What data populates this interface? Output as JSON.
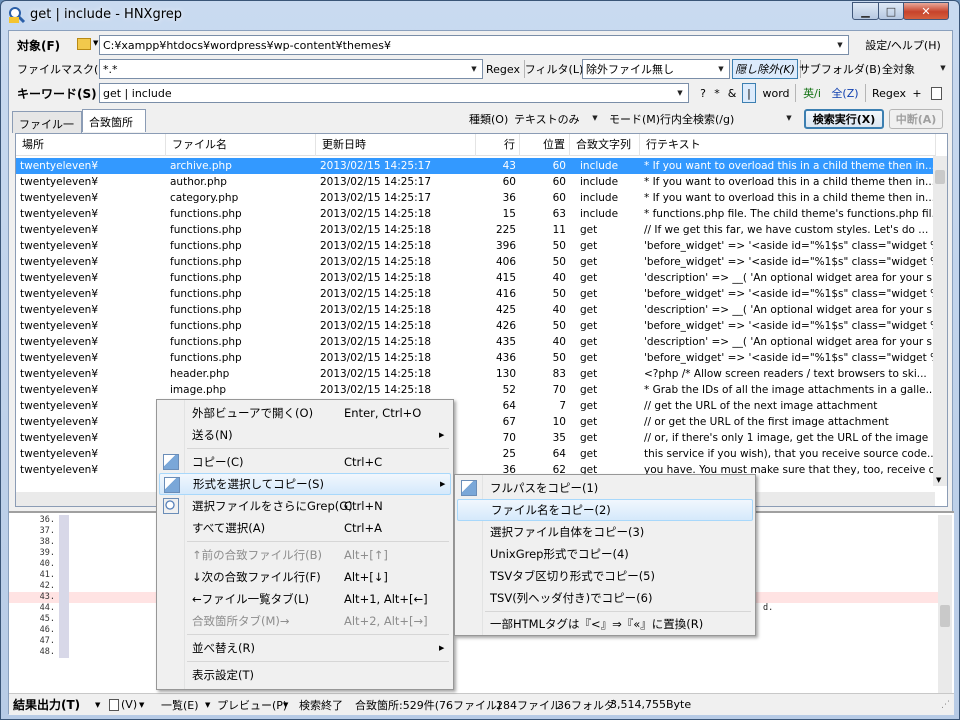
{
  "window": {
    "title": "get | include - HNXgrep"
  },
  "toolbar": {
    "target_label": "対象(F)",
    "target_path": "C:¥xampp¥htdocs¥wordpress¥wp-content¥themes¥",
    "settings_help": "設定/ヘルプ(H)",
    "filemask_label": "ファイルマスク(N)",
    "filemask_value": "*.*",
    "regex_label": "Regex",
    "filter_label": "フィルタ(L)",
    "filter_value": "除外ファイル無し",
    "hidden_exclude": "隠し除外(K)",
    "subfolder_label": "サブフォルダ(B)",
    "subfolder_value": "全対象",
    "keyword_label": "キーワード(S)",
    "keyword_value": "get | include",
    "kw_q": "?",
    "kw_star": "*",
    "kw_amp": "&",
    "kw_pipe": "|",
    "kw_word": "word",
    "kw_case": "英/i",
    "kw_zen": "全(Z)",
    "kw_regex": "Regex",
    "kw_plus": "+"
  },
  "tabs": [
    {
      "label": "ファイル一覧"
    },
    {
      "label": "合致箇所"
    }
  ],
  "search_opts": {
    "kind_label": "種類(O)",
    "kind_value": "テキストのみ",
    "mode_label": "モード(M)",
    "mode_value": "行内全検索(/g)",
    "run_button": "検索実行(X)",
    "stop_button": "中断(A)"
  },
  "grid": {
    "columns": [
      "場所",
      "ファイル名",
      "更新日時",
      "行",
      "位置",
      "合致文字列",
      "行テキスト"
    ],
    "rows": [
      [
        "twentyeleven¥",
        "archive.php",
        "2013/02/15 14:25:17",
        "43",
        "60",
        "include",
        "* If you want to overload this in a child theme then in..."
      ],
      [
        "twentyeleven¥",
        "author.php",
        "2013/02/15 14:25:17",
        "60",
        "60",
        "include",
        "* If you want to overload this in a child theme then in..."
      ],
      [
        "twentyeleven¥",
        "category.php",
        "2013/02/15 14:25:17",
        "36",
        "60",
        "include",
        "* If you want to overload this in a child theme then in..."
      ],
      [
        "twentyeleven¥",
        "functions.php",
        "2013/02/15 14:25:18",
        "15",
        "63",
        "include",
        "* functions.php file. The child theme's functions.php fil..."
      ],
      [
        "twentyeleven¥",
        "functions.php",
        "2013/02/15 14:25:18",
        "225",
        "11",
        "get",
        "// If we get this far, we have custom styles. Let's do ..."
      ],
      [
        "twentyeleven¥",
        "functions.php",
        "2013/02/15 14:25:18",
        "396",
        "50",
        "get",
        "'before_widget' => '<aside id=\"%1$s\" class=\"widget %2..."
      ],
      [
        "twentyeleven¥",
        "functions.php",
        "2013/02/15 14:25:18",
        "406",
        "50",
        "get",
        "'before_widget' => '<aside id=\"%1$s\" class=\"widget %2..."
      ],
      [
        "twentyeleven¥",
        "functions.php",
        "2013/02/15 14:25:18",
        "415",
        "40",
        "get",
        "'description' => __( 'An optional widget area for your si..."
      ],
      [
        "twentyeleven¥",
        "functions.php",
        "2013/02/15 14:25:18",
        "416",
        "50",
        "get",
        "'before_widget' => '<aside id=\"%1$s\" class=\"widget %2..."
      ],
      [
        "twentyeleven¥",
        "functions.php",
        "2013/02/15 14:25:18",
        "425",
        "40",
        "get",
        "'description' => __( 'An optional widget area for your si..."
      ],
      [
        "twentyeleven¥",
        "functions.php",
        "2013/02/15 14:25:18",
        "426",
        "50",
        "get",
        "'before_widget' => '<aside id=\"%1$s\" class=\"widget %2..."
      ],
      [
        "twentyeleven¥",
        "functions.php",
        "2013/02/15 14:25:18",
        "435",
        "40",
        "get",
        "'description' => __( 'An optional widget area for your si..."
      ],
      [
        "twentyeleven¥",
        "functions.php",
        "2013/02/15 14:25:18",
        "436",
        "50",
        "get",
        "'before_widget' => '<aside id=\"%1$s\" class=\"widget %2..."
      ],
      [
        "twentyeleven¥",
        "header.php",
        "2013/02/15 14:25:18",
        "130",
        "83",
        "get",
        "<?php /* Allow screen readers / text browsers to ski..."
      ],
      [
        "twentyeleven¥",
        "image.php",
        "2013/02/15 14:25:18",
        "52",
        "70",
        "get",
        "* Grab the IDs of all the image attachments in a galle..."
      ],
      [
        "twentyeleven¥",
        "",
        "",
        "64",
        "7",
        "get",
        "// get the URL of the next image attachment"
      ],
      [
        "twentyeleven¥",
        "",
        "",
        "67",
        "10",
        "get",
        "// or get the URL of the first image attachment"
      ],
      [
        "twentyeleven¥",
        "",
        "",
        "70",
        "35",
        "get",
        "// or, if there's only 1 image, get the URL of the image"
      ],
      [
        "twentyeleven¥",
        "",
        "",
        "25",
        "64",
        "get",
        "this service if you wish), that you receive source code..."
      ],
      [
        "twentyeleven¥",
        "",
        "",
        "36",
        "62",
        "get",
        "you have. You must make sure that they, too, receive o..."
      ]
    ]
  },
  "preview": {
    "lines": [
      {
        "num": "36.",
        "text": ""
      },
      {
        "num": "37.",
        "text": ""
      },
      {
        "num": "38.",
        "text": ""
      },
      {
        "num": "39.",
        "text": ""
      },
      {
        "num": "40.",
        "text": ""
      },
      {
        "num": "41.",
        "text": ""
      },
      {
        "num": "42.",
        "text": ""
      },
      {
        "num": "43.",
        "text": ""
      },
      {
        "num": "44.",
        "text": "d."
      },
      {
        "num": "45.",
        "text": ""
      },
      {
        "num": "46.",
        "text": "ormat() );"
      },
      {
        "num": "47.",
        "text": ""
      },
      {
        "num": "48.",
        "text": ""
      }
    ]
  },
  "status": {
    "output": "結果出力(T)",
    "v": "(V)",
    "list": "一覧(E)",
    "preview": "プレビュー(P)",
    "state": "検索終了",
    "matches": "合致箇所:529件(76ファイル)",
    "files": "284ファイル",
    "folders": "36フォルダ",
    "bytes": "3,514,755Byte"
  },
  "context_menu": {
    "items": [
      {
        "label": "外部ビューアで開く(O)",
        "shortcut": "Enter, Ctrl+O"
      },
      {
        "label": "送る(N)",
        "shortcut": ""
      },
      {
        "label": "コピー(C)",
        "shortcut": "Ctrl+C"
      },
      {
        "label": "形式を選択してコピー(S)",
        "shortcut": ""
      },
      {
        "label": "選択ファイルをさらにGrep(G)",
        "shortcut": "Ctrl+N"
      },
      {
        "label": "すべて選択(A)",
        "shortcut": "Ctrl+A"
      },
      {
        "label": "↑前の合致ファイル行(B)",
        "shortcut": "Alt+[↑]"
      },
      {
        "label": "↓次の合致ファイル行(F)",
        "shortcut": "Alt+[↓]"
      },
      {
        "label": "←ファイル一覧タブ(L)",
        "shortcut": "Alt+1, Alt+[←]"
      },
      {
        "label": "合致箇所タブ(M)→",
        "shortcut": "Alt+2, Alt+[→]"
      },
      {
        "label": "並べ替え(R)",
        "shortcut": ""
      },
      {
        "label": "表示設定(T)",
        "shortcut": ""
      }
    ]
  },
  "submenu": {
    "items": [
      {
        "label": "フルパスをコピー(1)"
      },
      {
        "label": "ファイル名をコピー(2)"
      },
      {
        "label": "選択ファイル自体をコピー(3)"
      },
      {
        "label": "UnixGrep形式でコピー(4)"
      },
      {
        "label": "TSVタブ区切り形式でコピー(5)"
      },
      {
        "label": "TSV(列ヘッダ付き)でコピー(6)"
      },
      {
        "label": "一部HTMLタグは『<』⇒『«』に置換(R)"
      }
    ]
  }
}
